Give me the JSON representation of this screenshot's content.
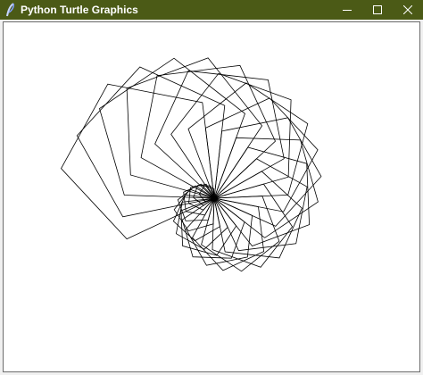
{
  "window": {
    "title": "Python Turtle Graphics",
    "titlebar_color": "#4b5a16",
    "icon": "python-feather-icon"
  },
  "controls": {
    "minimize_icon": "minimize-icon",
    "maximize_icon": "maximize-icon",
    "close_icon": "close-icon"
  },
  "canvas": {
    "background": "#ffffff",
    "stroke_color": "#000000",
    "drawing": "pentagon-spiral"
  }
}
